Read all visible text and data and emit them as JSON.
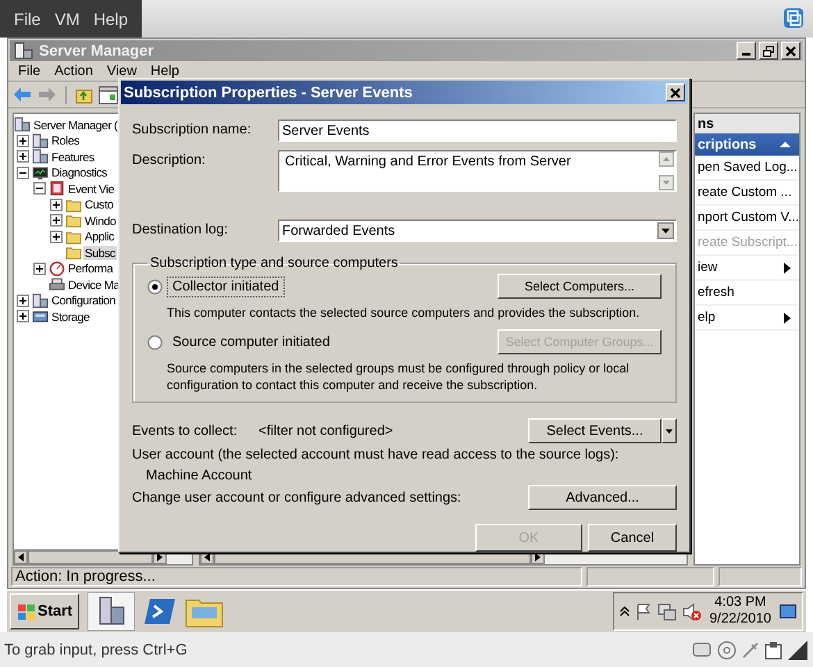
{
  "vm_menu": [
    "File",
    "VM",
    "Help"
  ],
  "server_manager": {
    "title": "Server Manager",
    "menu": [
      "File",
      "Action",
      "View",
      "Help"
    ],
    "tree": [
      {
        "label": "Server Manager (",
        "kind": "server",
        "selected": false,
        "children": [
          {
            "label": "Roles",
            "kind": "server",
            "selected": false,
            "expanded": false
          },
          {
            "label": "Features",
            "kind": "server",
            "selected": false,
            "expanded": false
          },
          {
            "label": "Diagnostics",
            "kind": "monitor",
            "selected": false,
            "expanded": true,
            "children": [
              {
                "label": "Event Vie",
                "kind": "log",
                "selected": false,
                "expanded": true,
                "children": [
                  {
                    "label": "Custo",
                    "kind": "folder",
                    "selected": false,
                    "expanded": false
                  },
                  {
                    "label": "Windo",
                    "kind": "folder",
                    "selected": false,
                    "expanded": false
                  },
                  {
                    "label": "Applic",
                    "kind": "folder",
                    "selected": false,
                    "expanded": false
                  },
                  {
                    "label": "Subsc",
                    "kind": "folder",
                    "selected": true
                  }
                ]
              },
              {
                "label": "Performa",
                "kind": "gauge",
                "selected": false,
                "expanded": false
              },
              {
                "label": "Device Ma",
                "kind": "device",
                "selected": false
              }
            ]
          },
          {
            "label": "Configuration",
            "kind": "server",
            "selected": false,
            "expanded": false
          },
          {
            "label": "Storage",
            "kind": "storage",
            "selected": false,
            "expanded": false
          }
        ]
      }
    ],
    "actions": {
      "header": "ns",
      "section": "criptions",
      "items": [
        {
          "label": "pen Saved Log...",
          "kind": "item",
          "disabled": false
        },
        {
          "label": "reate Custom ...",
          "kind": "item",
          "disabled": false
        },
        {
          "label": "nport Custom V...",
          "kind": "item",
          "disabled": false
        },
        {
          "label": "reate Subscript...",
          "kind": "item",
          "disabled": true
        },
        {
          "label": "iew",
          "kind": "submenu",
          "disabled": false
        },
        {
          "label": "efresh",
          "kind": "item",
          "disabled": false
        },
        {
          "label": "elp",
          "kind": "submenu",
          "disabled": false
        }
      ]
    },
    "status_bar": "Action:  In progress..."
  },
  "dialog": {
    "title": "Subscription Properties - Server Events",
    "name_label": "Subscription name:",
    "name_value": "Server Events",
    "description_label": "Description:",
    "description_value": "Critical, Warning and Error Events from Server",
    "destination_label": "Destination log:",
    "destination_value": "Forwarded Events",
    "group_title": "Subscription type and source computers",
    "options": [
      {
        "label": "Collector initiated",
        "selected": true,
        "button": "Select Computers...",
        "button_disabled": false,
        "note": "This computer contacts the selected source computers and provides the subscription."
      },
      {
        "label": "Source computer initiated",
        "selected": false,
        "button": "Select Computer Groups...",
        "button_disabled": true,
        "note": "Source computers in the selected groups must be configured through policy or local configuration to contact this computer and receive the subscription."
      }
    ],
    "events_label": "Events to collect:",
    "events_value": "<filter not configured>",
    "events_button": "Select Events...",
    "account_label": "User account (the selected account must have read access to the source logs):",
    "account_value": "Machine Account",
    "advanced_label": "Change user account or configure advanced settings:",
    "advanced_button": "Advanced...",
    "buttons": [
      {
        "label": "OK",
        "disabled": true
      },
      {
        "label": "Cancel",
        "disabled": false
      }
    ]
  },
  "taskbar": {
    "start": "Start",
    "time": "4:03 PM",
    "date": "9/22/2010"
  },
  "vm_status": "To grab input, press Ctrl+G"
}
